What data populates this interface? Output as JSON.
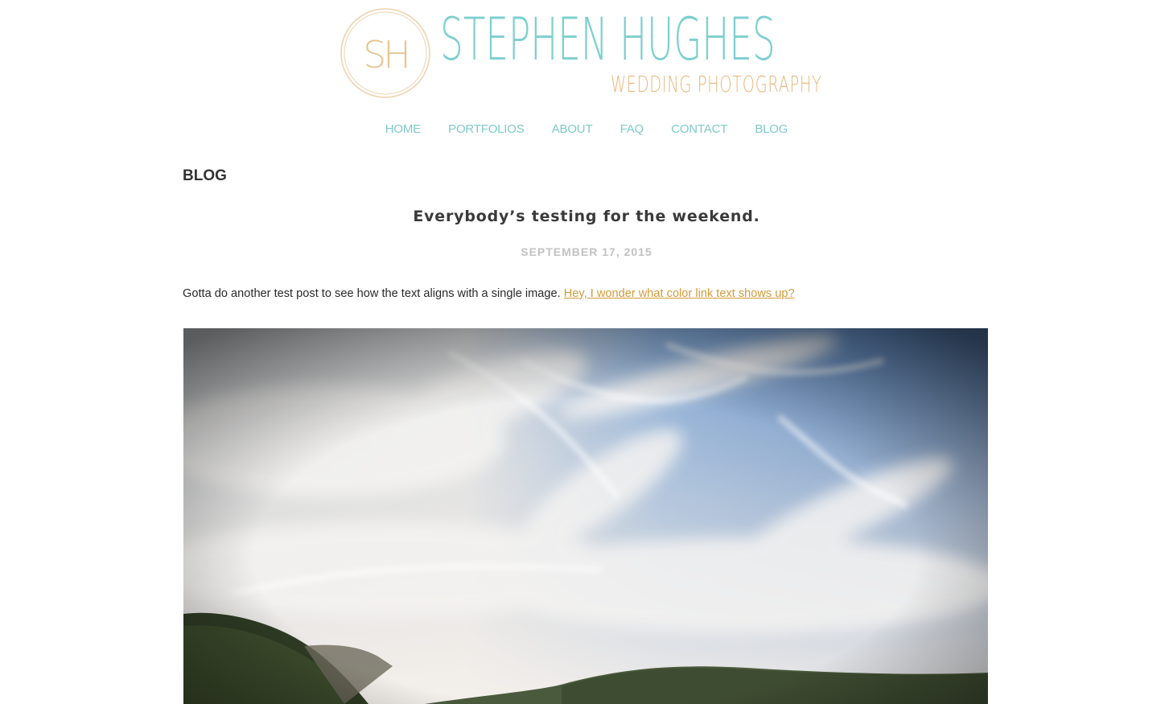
{
  "logo": {
    "monogram": "SH",
    "name": "STEPHEN HUGHES",
    "tagline": "WEDDING PHOTOGRAPHY",
    "name_color": "#7dcfcf",
    "tagline_color": "#e8b77c"
  },
  "nav": {
    "items": [
      {
        "label": "HOME"
      },
      {
        "label": "PORTFOLIOS"
      },
      {
        "label": "ABOUT"
      },
      {
        "label": "FAQ"
      },
      {
        "label": "CONTACT"
      },
      {
        "label": "BLOG"
      }
    ],
    "color": "#7fcaca"
  },
  "page": {
    "section_title": "BLOG"
  },
  "post": {
    "title": "Everybody’s testing for the weekend.",
    "date": "SEPTEMBER 17, 2015",
    "body_text": "Gotta do another test post to see how the text aligns with a single image. ",
    "link_text": "Hey, I wonder what color link text shows up? ",
    "link_color": "#d39b3a"
  },
  "image": {
    "icon": "landscape-photo"
  }
}
